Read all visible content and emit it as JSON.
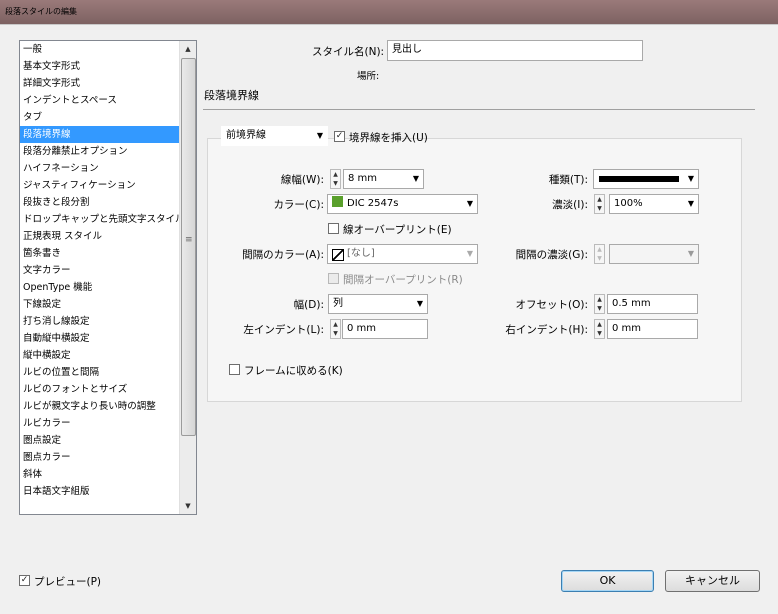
{
  "window": {
    "title": "段落スタイルの編集"
  },
  "sidebar": {
    "items": [
      {
        "label": "一般"
      },
      {
        "label": "基本文字形式"
      },
      {
        "label": "詳細文字形式"
      },
      {
        "label": "インデントとスペース"
      },
      {
        "label": "タブ"
      },
      {
        "label": "段落境界線",
        "selected": true
      },
      {
        "label": "段落分離禁止オプション"
      },
      {
        "label": "ハイフネーション"
      },
      {
        "label": "ジャスティフィケーション"
      },
      {
        "label": "段抜きと段分割"
      },
      {
        "label": "ドロップキャップと先頭文字スタイル"
      },
      {
        "label": "正規表現 スタイル"
      },
      {
        "label": "箇条書き"
      },
      {
        "label": "文字カラー"
      },
      {
        "label": "OpenType 機能"
      },
      {
        "label": "下線設定"
      },
      {
        "label": "打ち消し線設定"
      },
      {
        "label": "自動縦中横設定"
      },
      {
        "label": "縦中横設定"
      },
      {
        "label": "ルビの位置と間隔"
      },
      {
        "label": "ルビのフォントとサイズ"
      },
      {
        "label": "ルビが親文字より長い時の調整"
      },
      {
        "label": "ルビカラー"
      },
      {
        "label": "圏点設定"
      },
      {
        "label": "圏点カラー"
      },
      {
        "label": "斜体"
      },
      {
        "label": "日本語文字組版"
      }
    ]
  },
  "header": {
    "style_name_label": "スタイル名(N):",
    "style_name_value": "見出し",
    "location_label": "場所:",
    "section_title": "段落境界線"
  },
  "rule": {
    "position_select": "前境界線",
    "rule_on_label": "境界線を挿入(U)",
    "rule_on_checked": true,
    "weight_label": "線幅(W):",
    "weight_value": "8 mm",
    "type_label": "種類(T):",
    "color_label": "カラー(C):",
    "color_value": "DIC 2547s",
    "color_swatch": "#5aa02c",
    "tint_label": "濃淡(I):",
    "tint_value": "100%",
    "overprint_label": "線オーバープリント(E)",
    "gap_color_label": "間隔のカラー(A):",
    "gap_color_value": "[なし]",
    "gap_tint_label": "間隔の濃淡(G):",
    "gap_overprint_label": "間隔オーバープリント(R)",
    "width_label": "幅(D):",
    "width_value": "列",
    "offset_label": "オフセット(O):",
    "offset_value": "0.5 mm",
    "left_indent_label": "左インデント(L):",
    "left_indent_value": "0 mm",
    "right_indent_label": "右インデント(H):",
    "right_indent_value": "0 mm",
    "keep_in_frame_label": "フレームに収める(K)"
  },
  "footer": {
    "preview_label": "プレビュー(P)",
    "preview_checked": true,
    "ok_label": "OK",
    "cancel_label": "キャンセル"
  }
}
